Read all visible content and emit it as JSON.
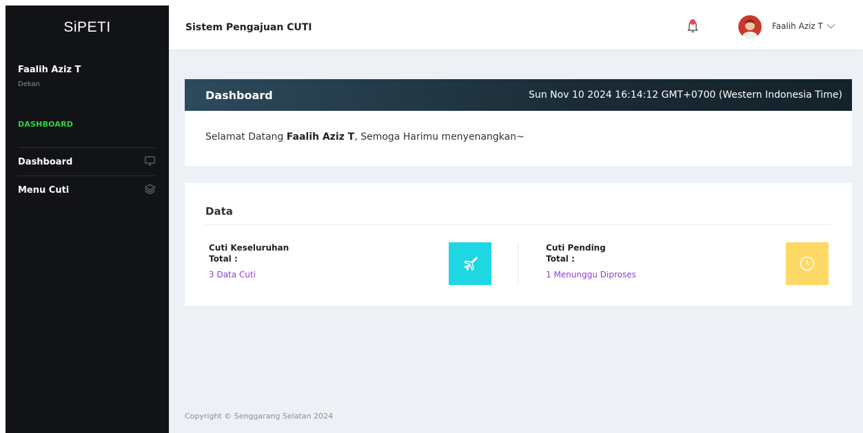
{
  "sidebar": {
    "brand": "SiPETI",
    "user_name": "Faalih Aziz T",
    "user_role": "Dekan",
    "section_title": "DASHBOARD",
    "items": [
      {
        "label": "Dashboard",
        "icon": "monitor-icon"
      },
      {
        "label": "Menu Cuti",
        "icon": "layers-icon"
      }
    ]
  },
  "header": {
    "title": "Sistem Pengajuan CUTI",
    "user_menu": "Faalih Aziz T",
    "bell_icon": "bell-icon",
    "dropdown_icon": "chevron-down-icon"
  },
  "dashboard": {
    "title": "Dashboard",
    "datetime": "Sun Nov 10 2024 16:14:12 GMT+0700 (Western Indonesia Time)",
    "greeting_prefix": "Selamat Datang ",
    "greeting_name": "Faalih Aziz T",
    "greeting_suffix": ", Semoga Harimu menyenangkan~"
  },
  "data": {
    "title": "Data",
    "stats": [
      {
        "label": "Cuti Keseluruhan",
        "sublabel": "Total :",
        "value": "3 Data Cuti",
        "icon": "airplane-icon",
        "color": "#1fd6e3"
      },
      {
        "label": "Cuti Pending",
        "sublabel": "Total :",
        "value": "1 Menunggu Diproses",
        "icon": "clock-icon",
        "color": "#ffd966"
      }
    ]
  },
  "footer": {
    "text": "Copyright © Senggarang Selatan 2024"
  },
  "colors": {
    "sidebar_bg": "#111317",
    "accent_green": "#2fd33b",
    "link_purple": "#8b3fd6",
    "header_dark": "#1a2b35",
    "bell_accent": "#e8445a"
  }
}
